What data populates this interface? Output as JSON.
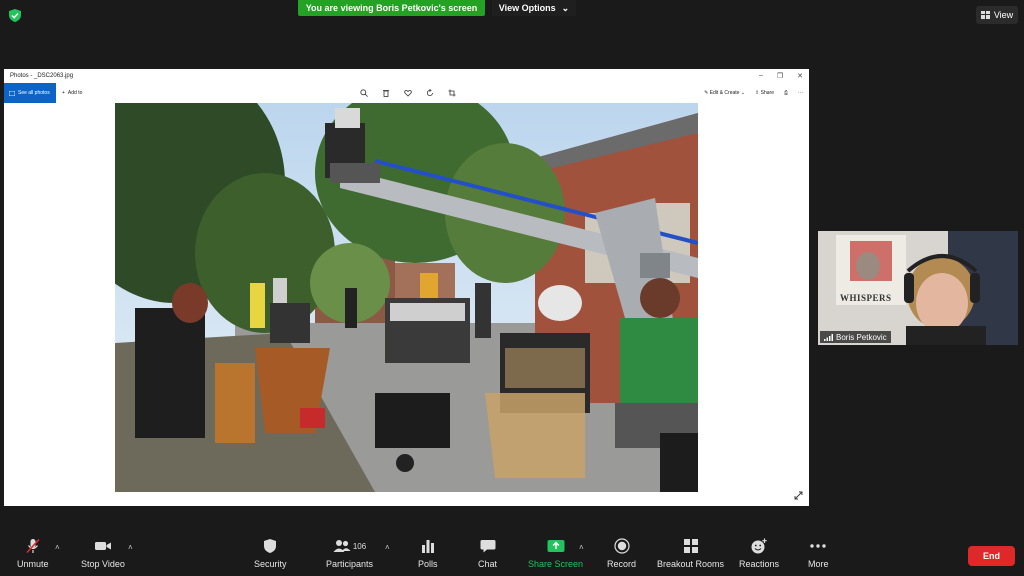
{
  "top": {
    "banner_text": "You are viewing Boris Petkovic's screen",
    "view_options_label": "View Options",
    "view_label": "View"
  },
  "shared_window": {
    "title": "Photos - _DSC2063.jpg",
    "see_all_photos": "See all photos",
    "add_to": "Add to",
    "edit_create": "Edit & Create",
    "share": "Share"
  },
  "participant": {
    "name": "Boris Petkovic",
    "poster_text": "WHISPERS"
  },
  "controls": {
    "unmute": "Unmute",
    "stop_video": "Stop Video",
    "security": "Security",
    "participants": "Participants",
    "participants_count": "106",
    "polls": "Polls",
    "chat": "Chat",
    "share_screen": "Share Screen",
    "record": "Record",
    "breakout_rooms": "Breakout Rooms",
    "reactions": "Reactions",
    "more": "More",
    "end": "End"
  },
  "colors": {
    "banner_green": "#23a223",
    "share_green": "#23c45e",
    "end_red": "#e02828",
    "photos_blue": "#0c65c6"
  }
}
